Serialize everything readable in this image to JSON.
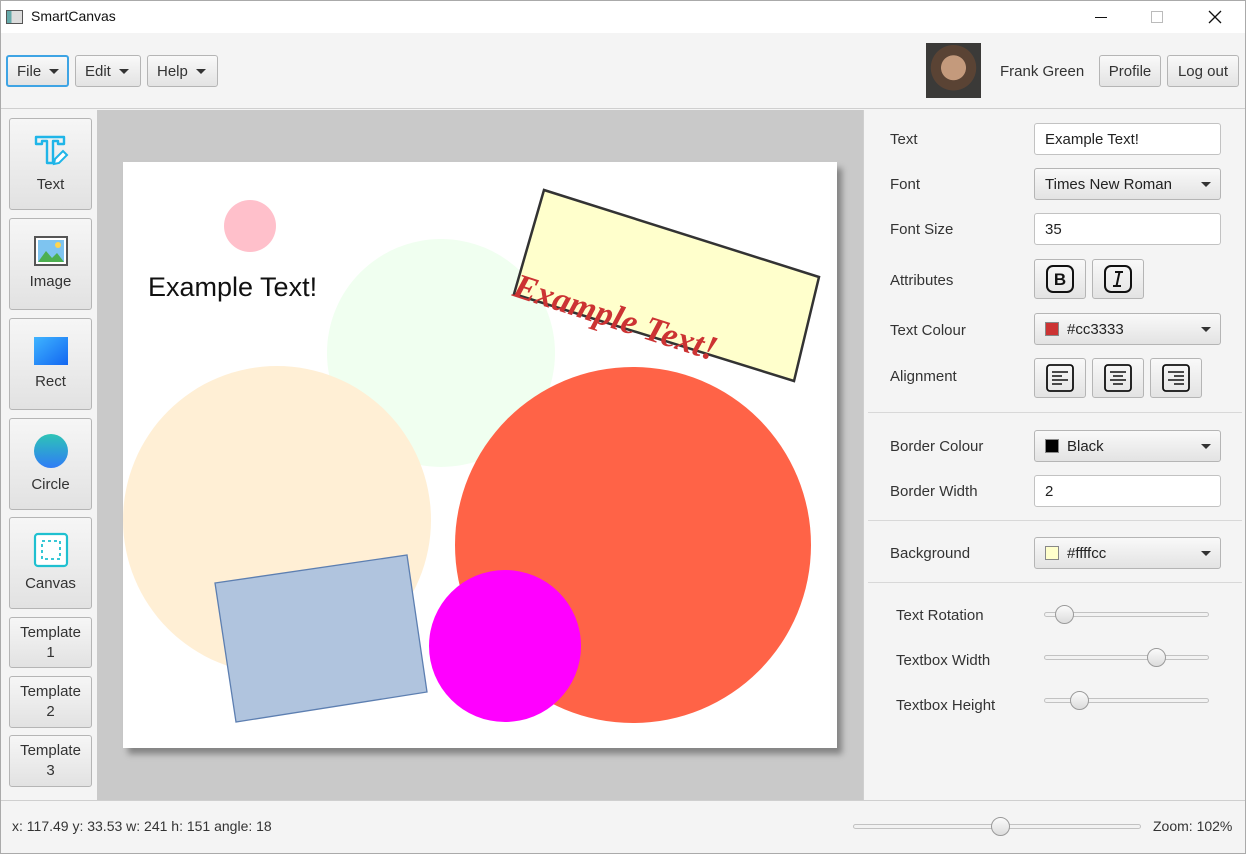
{
  "window": {
    "title": "SmartCanvas"
  },
  "menus": [
    {
      "label": "File"
    },
    {
      "label": "Edit"
    },
    {
      "label": "Help"
    }
  ],
  "user": {
    "name": "Frank Green",
    "profile_label": "Profile",
    "logout_label": "Log out"
  },
  "tools": [
    {
      "label": "Text",
      "icon": "text-tool-icon"
    },
    {
      "label": "Image",
      "icon": "image-icon"
    },
    {
      "label": "Rect",
      "icon": "rectangle-icon"
    },
    {
      "label": "Circle",
      "icon": "circle-icon"
    },
    {
      "label": "Canvas",
      "icon": "canvas-icon"
    }
  ],
  "templates": [
    {
      "line1": "Template",
      "line2": "1"
    },
    {
      "line1": "Template",
      "line2": "2"
    },
    {
      "line1": "Template",
      "line2": "3"
    }
  ],
  "canvas": {
    "plain_text": "Example Text!",
    "rotated_text": "Example Text!",
    "rotated_text_color": "#cc3333",
    "rotated_text_background": "#ffffcc",
    "colors": {
      "small_pink": "#ffc0cb",
      "mint": "#f0fff0",
      "peach": "#ffefd5",
      "tomato": "#ff6347",
      "steel": "#b0c4de",
      "magenta": "#ff00ff"
    }
  },
  "properties": {
    "text_label": "Text",
    "text_value": "Example Text!",
    "font_label": "Font",
    "font_value": "Times New Roman",
    "font_size_label": "Font Size",
    "font_size_value": "35",
    "attributes_label": "Attributes",
    "text_colour_label": "Text Colour",
    "text_colour_value": "#cc3333",
    "alignment_label": "Alignment",
    "border_colour_label": "Border Colour",
    "border_colour_value": "Black",
    "border_width_label": "Border Width",
    "border_width_value": "2",
    "background_label": "Background",
    "background_value": "#ffffcc",
    "text_rotation_label": "Text Rotation",
    "text_rotation_level": 0.07,
    "textbox_width_label": "Textbox Width",
    "textbox_width_level": 0.7,
    "textbox_height_label": "Textbox Height",
    "textbox_height_level": 0.17
  },
  "status": {
    "info": "x: 117.49 y: 33.53 w: 241 h: 151 angle: 18",
    "zoom_label": "Zoom: 102%",
    "zoom_level": 0.51
  }
}
